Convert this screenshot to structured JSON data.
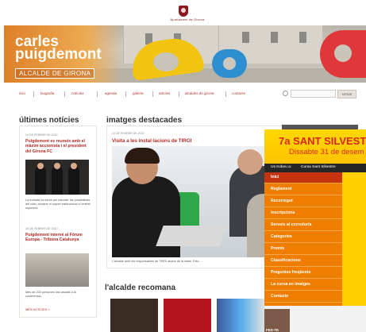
{
  "header": {
    "city_label": "Ajuntament de Girona"
  },
  "banner": {
    "title_line1": "carles",
    "title_line2": "puigdemont",
    "subtitle": "ALCALDE DE GIRONA"
  },
  "nav": {
    "items": [
      "inici",
      "biografia",
      "notícies",
      "agenda",
      "galeria",
      "articles",
      "alcaldes de girona",
      "contacte"
    ],
    "search_button": "cercar"
  },
  "news": {
    "heading": "últimes notícies",
    "items": [
      {
        "date": "24 DE FEBRER DE 2010",
        "title": "Puigdemont es reuneix amb el màxim accionista i el president del Girona FC",
        "text": "La trobada ha servit per estudiar les possibilitats del club i mostrar el suport institucional a l'entitat esportiva"
      },
      {
        "date": "18 DE FEBRER DE 2010",
        "title": "Puigdemont intervé al Fòrum Europa - Tribuna Catalunya",
        "text": "Més de 200 persones han assistit a la conferència"
      }
    ],
    "more": "MÉS NOTÍCIES »"
  },
  "featured": {
    "heading": "imatges destacades",
    "date": "14 DE FEBRER DE 2010",
    "title": "Visita a les instal·lacions de TIRGI",
    "caption": "L'alcalde amb els responsables de TIRGI abans de la visita. Foto: ..."
  },
  "recommend": {
    "heading": "l'alcalde recomana"
  },
  "overlay": {
    "title1": "7a SANT SILVEST",
    "title2": "Dissabte 31 de desem",
    "breadcrumb_label": "Us trobeu a:",
    "breadcrumb_link": "Cursa Sant Silvestre",
    "menu": [
      "Inici",
      "Reglament",
      "Recorregut",
      "Inscripcions",
      "Serveis al corredor/a",
      "Categories",
      "Premis",
      "Classificacions",
      "Preguntes freqüents",
      "La cursa en imatges",
      "Contacte"
    ],
    "fes_label": "FES-TE"
  },
  "colors": {
    "accent_red": "#b22a22",
    "overlay_orange": "#ee7d00",
    "overlay_yellow": "#ffd800"
  }
}
